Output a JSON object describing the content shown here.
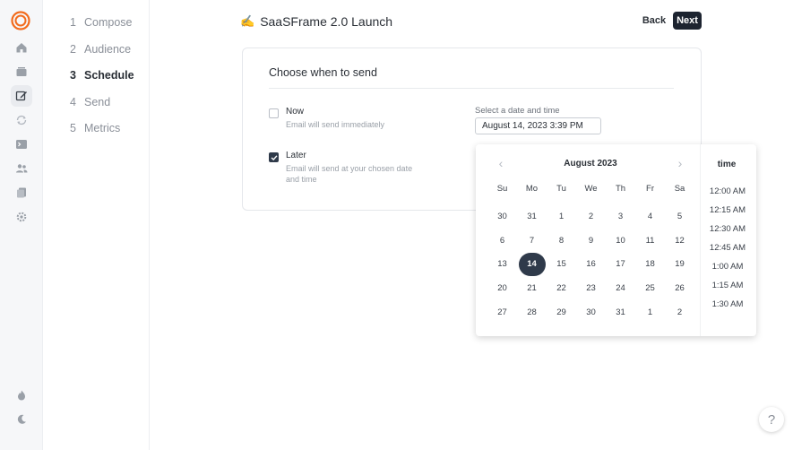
{
  "header": {
    "title_emoji": "✍️",
    "title": "SaaSFrame 2.0 Launch",
    "back_label": "Back",
    "next_label": "Next"
  },
  "rail": {
    "icons": [
      "logo-icon",
      "home-icon",
      "inbox-icon",
      "edit-icon",
      "refresh-icon",
      "terminal-icon",
      "users-icon",
      "documents-icon",
      "gear-icon",
      "fire-icon",
      "moon-icon"
    ]
  },
  "steps": [
    {
      "num": "1",
      "label": "Compose"
    },
    {
      "num": "2",
      "label": "Audience"
    },
    {
      "num": "3",
      "label": "Schedule"
    },
    {
      "num": "4",
      "label": "Send"
    },
    {
      "num": "5",
      "label": "Metrics"
    }
  ],
  "card": {
    "title": "Choose when to send",
    "now": {
      "label": "Now",
      "desc": "Email will send immediately",
      "checked": false
    },
    "later": {
      "label": "Later",
      "desc": "Email will send at your chosen date and time",
      "checked": true
    },
    "datetime_label": "Select a date and time",
    "datetime_value": "August 14, 2023 3:39 PM"
  },
  "datepicker": {
    "month": "August 2023",
    "weekdays": [
      "Su",
      "Mo",
      "Tu",
      "We",
      "Th",
      "Fr",
      "Sa"
    ],
    "days": [
      "30",
      "31",
      "1",
      "2",
      "3",
      "4",
      "5",
      "6",
      "7",
      "8",
      "9",
      "10",
      "11",
      "12",
      "13",
      "14",
      "15",
      "16",
      "17",
      "18",
      "19",
      "20",
      "21",
      "22",
      "23",
      "24",
      "25",
      "26",
      "27",
      "28",
      "29",
      "30",
      "31",
      "1",
      "2"
    ],
    "selected_day": "14",
    "time_header": "time",
    "times": [
      "12:00 AM",
      "12:15 AM",
      "12:30 AM",
      "12:45 AM",
      "1:00 AM",
      "1:15 AM",
      "1:30 AM"
    ]
  },
  "help_label": "?",
  "colors": {
    "accent": "#f26b1d",
    "primary_dark": "#1d2430",
    "selected": "#2f3a4a"
  }
}
